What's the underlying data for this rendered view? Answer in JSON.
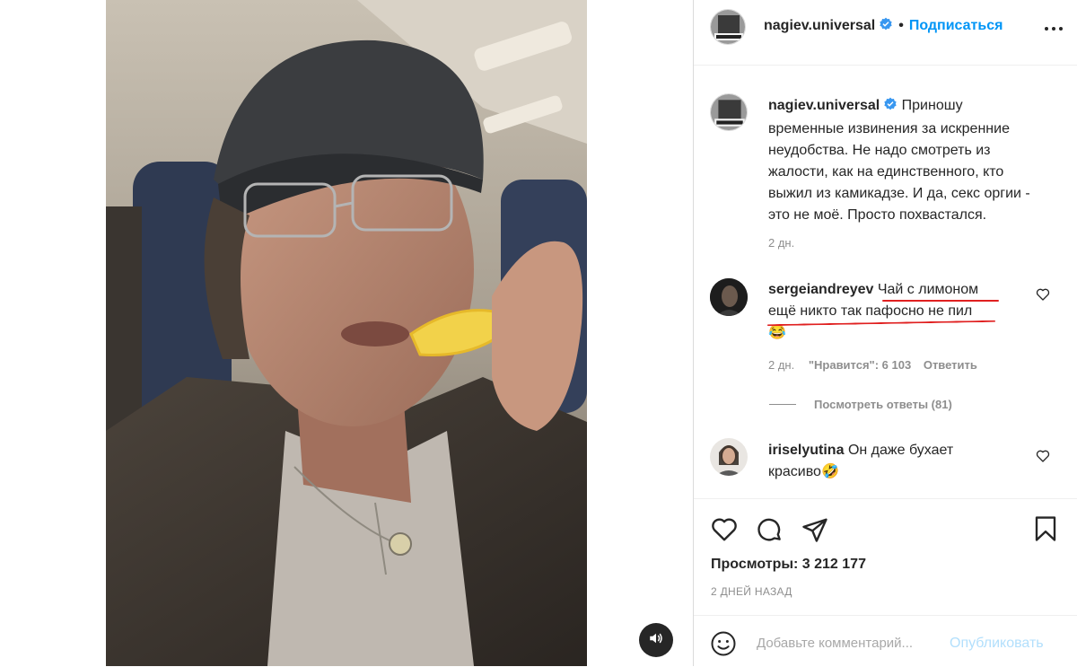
{
  "post": {
    "author": "nagiev.universal",
    "follow_label": "Подписаться",
    "dot": "•",
    "caption": "Приношу временные извинения за искренние неудобства. Не надо смотреть из жалости, как на единственного, кто выжил из камикадзе. И да, секс оргии - это не моё. Просто похвастался.",
    "caption_time": "2 дн."
  },
  "comments": [
    {
      "user": "sergeiandreyev",
      "line1": "Чай с лимоном",
      "line2": "ещё никто так пафосно не пил",
      "emoji": "😂",
      "time": "2 дн.",
      "likes_label": "\"Нравится\": 6 103",
      "reply_label": "Ответить",
      "view_replies": "Посмотреть ответы (81)"
    },
    {
      "user": "iriselyutina",
      "line1": "Он даже бухает",
      "line2": "красиво",
      "emoji": "🤣"
    }
  ],
  "stats": {
    "views_label": "Просмотры: 3 212 177",
    "date": "2 ДНЕЙ НАЗАД"
  },
  "comment_box": {
    "placeholder": "Добавьте комментарий...",
    "publish_label": "Опубликовать"
  },
  "icons": [
    "more-options-icon",
    "verified-badge-icon",
    "heart-icon",
    "comment-icon",
    "share-icon",
    "bookmark-icon",
    "emoji-icon",
    "volume-icon"
  ],
  "colors": {
    "link": "#0095f6",
    "verified": "#3897f0",
    "secondary": "#8e8e8e",
    "underline": "#e02020",
    "publish_disabled": "#b2dffc"
  }
}
